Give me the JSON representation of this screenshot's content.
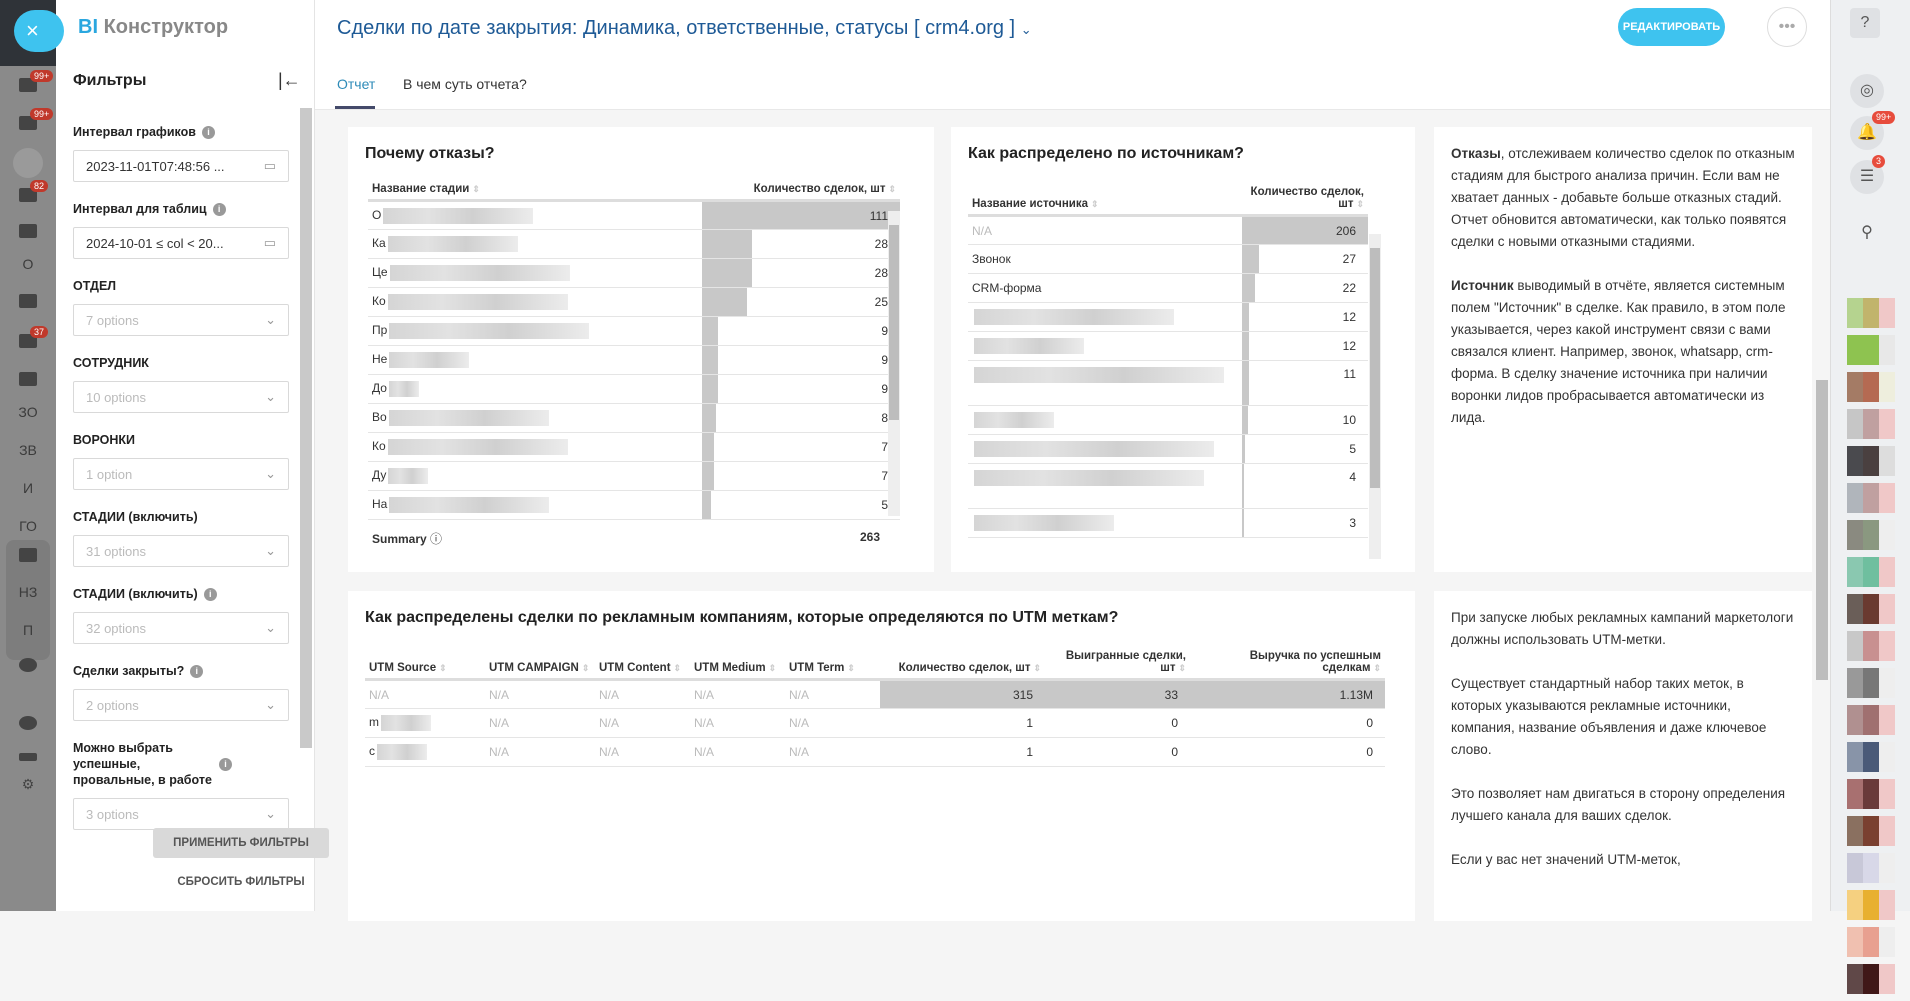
{
  "rail": {
    "close": "×",
    "badges": [
      "99+",
      "99+",
      "82",
      "37"
    ],
    "letters": [
      "О",
      "ЗО",
      "ЗВ",
      "И",
      "ГО",
      "НЗ",
      "П"
    ]
  },
  "filters": {
    "logo_bi": "BI",
    "logo_text": "Конструктор",
    "title": "Фильтры",
    "items": [
      {
        "label": "Интервал графиков",
        "value": "2023-11-01T07:48:56 ...",
        "info": true,
        "type": "date"
      },
      {
        "label": "Интервал для таблиц",
        "value": "2024-10-01 ≤ col < 20...",
        "info": true,
        "type": "date"
      },
      {
        "label": "ОТДЕЛ",
        "value": "7 options"
      },
      {
        "label": "СОТРУДНИК",
        "value": "10 options"
      },
      {
        "label": "ВОРОНКИ",
        "value": "1 option"
      },
      {
        "label": "СТАДИИ (включить)",
        "value": "31 options"
      },
      {
        "label": "СТАДИИ (включить)",
        "value": "32 options",
        "info": true
      },
      {
        "label": "Сделки закрыты?",
        "value": "2 options",
        "info": true
      },
      {
        "label": "Можно выбрать успешные, провальные, в работе",
        "value": "3 options",
        "info": true
      }
    ],
    "apply": "ПРИМЕНИТЬ ФИЛЬТРЫ",
    "reset": "СБРОСИТЬ ФИЛЬТРЫ"
  },
  "header": {
    "title": "Сделки по дате закрытия: Динамика, ответственные, статусы [ crm4.org ]",
    "edit": "РЕДАКТИРОВАТЬ",
    "tabs": [
      "Отчет",
      "В чем суть отчета?"
    ]
  },
  "refusals": {
    "title": "Почему отказы?",
    "col1": "Название стадии",
    "col2": "Количество сделок, шт",
    "rows": [
      {
        "p": "О",
        "v": 111
      },
      {
        "p": "Ка",
        "v": 28
      },
      {
        "p": "Це",
        "v": 28
      },
      {
        "p": "Ко",
        "v": 25
      },
      {
        "p": "Пр",
        "v": 9
      },
      {
        "p": "Не",
        "v": 9
      },
      {
        "p": "До",
        "v": 9
      },
      {
        "p": "Во",
        "v": 8
      },
      {
        "p": "Ко",
        "v": 7
      },
      {
        "p": "Ду",
        "v": 7
      },
      {
        "p": "На",
        "v": 5
      }
    ],
    "summary_label": "Summary",
    "summary_value": "263"
  },
  "sources": {
    "title": "Как распределено по источникам?",
    "col1": "Название источника",
    "col2": "Количество сделок, шт",
    "rows": [
      {
        "name": "N/A",
        "v": 206,
        "na": true
      },
      {
        "name": "Звонок",
        "v": 27
      },
      {
        "name": "CRM-форма",
        "v": 22
      },
      {
        "name": "",
        "v": 12
      },
      {
        "name": "",
        "v": 12
      },
      {
        "name": "",
        "v": 11
      },
      {
        "name": "",
        "v": 10
      },
      {
        "name": "",
        "v": 5
      },
      {
        "name": "",
        "v": 4
      },
      {
        "name": "",
        "v": 3
      }
    ]
  },
  "utm": {
    "title": "Как распределены сделки по рекламным компаниям, которые определяются по UTM меткам?",
    "cols": [
      "UTM Source",
      "UTM CAMPAIGN",
      "UTM Content",
      "UTM Medium",
      "UTM Term",
      "Количество сделок, шт",
      "Выигранные сделки, шт",
      "Выручка по успешным сделкам"
    ],
    "rows": [
      [
        "N/A",
        "N/A",
        "N/A",
        "N/A",
        "N/A",
        "315",
        "33",
        "1.13M"
      ],
      [
        "m",
        "N/A",
        "N/A",
        "N/A",
        "N/A",
        "1",
        "0",
        "0"
      ],
      [
        "c",
        "N/A",
        "N/A",
        "N/A",
        "N/A",
        "1",
        "0",
        "0"
      ]
    ]
  },
  "text1": {
    "b1": "Отказы",
    "p1": ", отслеживаем количество сделок по отказным стадиям для быстрого анализа причин. Если вам не хватает данных - добавьте больше отказных стадий. Отчет обновится автоматически, как только появятся сделки с новыми отказными стадиями.",
    "b2": "Источник",
    "p2": " выводимый в отчёте, является системным полем \"Источник\" в сделке. Как правило, в этом поле указывается, через какой инструмент связи с вами связался клиент. Например, звонок, whatsapp, crm-форма. В сделку значение источника при наличии воронки лидов пробрасывается автоматически из лида."
  },
  "text2": {
    "p1": "При запуске любых рекламных кампаний маркетологи должны использовать UTM-метки.",
    "p2": "Существует стандартный набор таких меток, в которых указываются рекламные источники, компания, название объявления и даже ключевое слово.",
    "p3": "Это позволяет нам двигаться в сторону определения лучшего канала для ваших сделок.",
    "p4": "Если у вас нет значений UTM-меток,"
  },
  "rrail": {
    "bell_badge": "99+",
    "chat_badge": "3"
  },
  "colors": {
    "accent": "#3ec3ef",
    "title": "#1e5a96",
    "bar": "#c8c8c8"
  }
}
